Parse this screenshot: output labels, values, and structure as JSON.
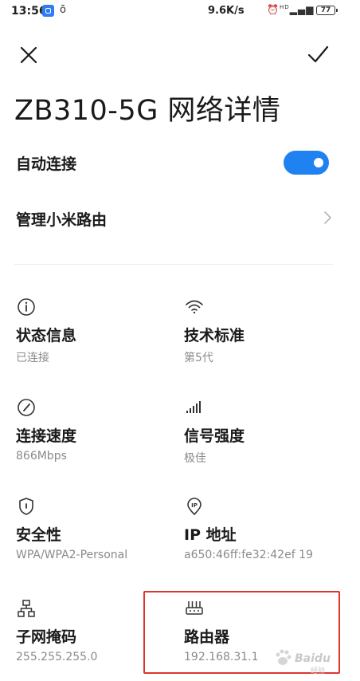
{
  "status_bar": {
    "time": "13:56",
    "network_speed": "9.6K/s",
    "signal_hd": "HD",
    "battery": "77"
  },
  "header": {
    "title": "ZB310-5G 网络详情"
  },
  "settings": {
    "auto_connect_label": "自动连接",
    "auto_connect_on": true,
    "manage_router_label": "管理小米路由"
  },
  "details": [
    {
      "icon": "info-icon",
      "title": "状态信息",
      "value": "已连接"
    },
    {
      "icon": "wifi-icon",
      "title": "技术标准",
      "value": "第5代"
    },
    {
      "icon": "speedometer-icon",
      "title": "连接速度",
      "value": "866Mbps"
    },
    {
      "icon": "signal-bars-icon",
      "title": "信号强度",
      "value": "极佳"
    },
    {
      "icon": "shield-icon",
      "title": "安全性",
      "value": "WPA/WPA2-Personal"
    },
    {
      "icon": "ip-pin-icon",
      "title": "IP 地址",
      "value": "a650:46ff:fe32:42ef 19"
    },
    {
      "icon": "network-topology-icon",
      "title": "子网掩码",
      "value": "255.255.255.0"
    },
    {
      "icon": "router-icon",
      "title": "路由器",
      "value": "192.168.31.1"
    }
  ],
  "watermark": {
    "text": "Baidu",
    "sub": "经验"
  },
  "colors": {
    "accent": "#1f82f0",
    "highlight": "#e0352f",
    "secondary_text": "#8a8a8a"
  }
}
